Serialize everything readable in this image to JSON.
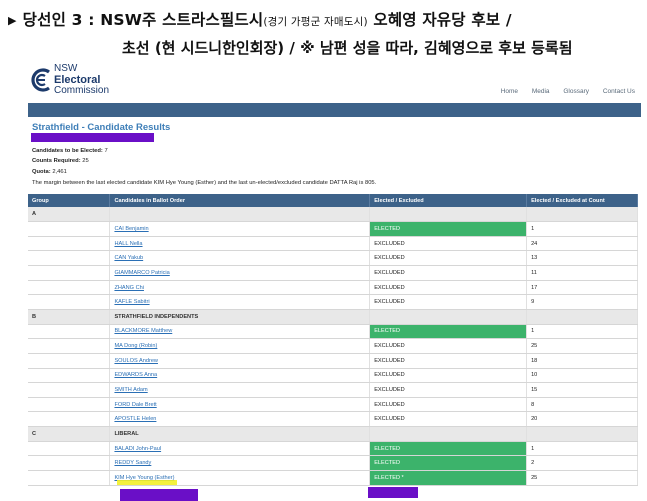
{
  "caption": {
    "bullet": "▶",
    "line1_main": "당선인 3 : NSW주 스트라스필드시",
    "line1_small": "(경기 가평군 자매도시)",
    "line1_tail": " 오혜영 자유당 후보 /",
    "line2_main": "초선 (현 시드니한인회장) / ※ 남편 성을 따라, 김혜영으로 후보 등록됨"
  },
  "site": {
    "logo_lines": [
      "NSW",
      "Electoral",
      "Commission"
    ],
    "nav": [
      "Home",
      "Media",
      "Glossary",
      "Contact Us"
    ],
    "page_title": "Strathfield - Candidate Results",
    "candidates_to_be_elected_label": "Candidates to be Elected:",
    "candidates_to_be_elected": "7",
    "counts_required_label": "Counts Required:",
    "counts_required": "25",
    "quota_label": "Quota:",
    "quota": "2,461",
    "margin_note": "The margin between the last elected candidate KIM Hye Young (Esther) and the last un-elected/excluded candidate DATTA Raj is 805."
  },
  "table": {
    "headers": [
      "Group",
      "Candidates in Ballot Order",
      "Elected / Excluded",
      "Elected / Excluded at Count"
    ],
    "rows": [
      {
        "group": "A",
        "name": "",
        "status": "",
        "count": "",
        "is_group": true
      },
      {
        "group": "",
        "name": "CAI Benjamin",
        "status": "ELECTED",
        "count": "1",
        "elected": true
      },
      {
        "group": "",
        "name": "HALL Nella",
        "status": "EXCLUDED",
        "count": "24"
      },
      {
        "group": "",
        "name": "CAN Yakub",
        "status": "EXCLUDED",
        "count": "13"
      },
      {
        "group": "",
        "name": "GIAMMARCO Patricia",
        "status": "EXCLUDED",
        "count": "11"
      },
      {
        "group": "",
        "name": "ZHANG Chi",
        "status": "EXCLUDED",
        "count": "17"
      },
      {
        "group": "",
        "name": "KAFLE Sabitri",
        "status": "EXCLUDED",
        "count": "9"
      },
      {
        "group": "B",
        "name": "STRATHFIELD INDEPENDENTS",
        "status": "",
        "count": "",
        "is_group": true
      },
      {
        "group": "",
        "name": "BLACKMORE Matthew",
        "status": "ELECTED",
        "count": "1",
        "elected": true
      },
      {
        "group": "",
        "name": "MA Dong (Robin)",
        "status": "EXCLUDED",
        "count": "25"
      },
      {
        "group": "",
        "name": "SOULOS Andrew",
        "status": "EXCLUDED",
        "count": "18"
      },
      {
        "group": "",
        "name": "EDWARDS Anna",
        "status": "EXCLUDED",
        "count": "10"
      },
      {
        "group": "",
        "name": "SMITH Adam",
        "status": "EXCLUDED",
        "count": "15"
      },
      {
        "group": "",
        "name": "FORD Dale Brett",
        "status": "EXCLUDED",
        "count": "8"
      },
      {
        "group": "",
        "name": "APOSTLE Helen",
        "status": "EXCLUDED",
        "count": "20"
      },
      {
        "group": "C",
        "name": "LIBERAL",
        "status": "",
        "count": "",
        "is_group": true
      },
      {
        "group": "",
        "name": "BALADI John-Paul",
        "status": "ELECTED",
        "count": "1",
        "elected": true
      },
      {
        "group": "",
        "name": "REDDY Sandy",
        "status": "ELECTED",
        "count": "2",
        "elected": true
      },
      {
        "group": "",
        "name": "KIM Hye Young (Esther)",
        "status": "ELECTED *",
        "count": "25",
        "elected": true
      }
    ]
  },
  "colors": {
    "header_blue": "#3d6289",
    "title_blue": "#3f7fb8",
    "elected_green": "#3cb36b",
    "highlight_purple": "#6a0fc7",
    "highlight_yellow": "#f2f02a"
  }
}
